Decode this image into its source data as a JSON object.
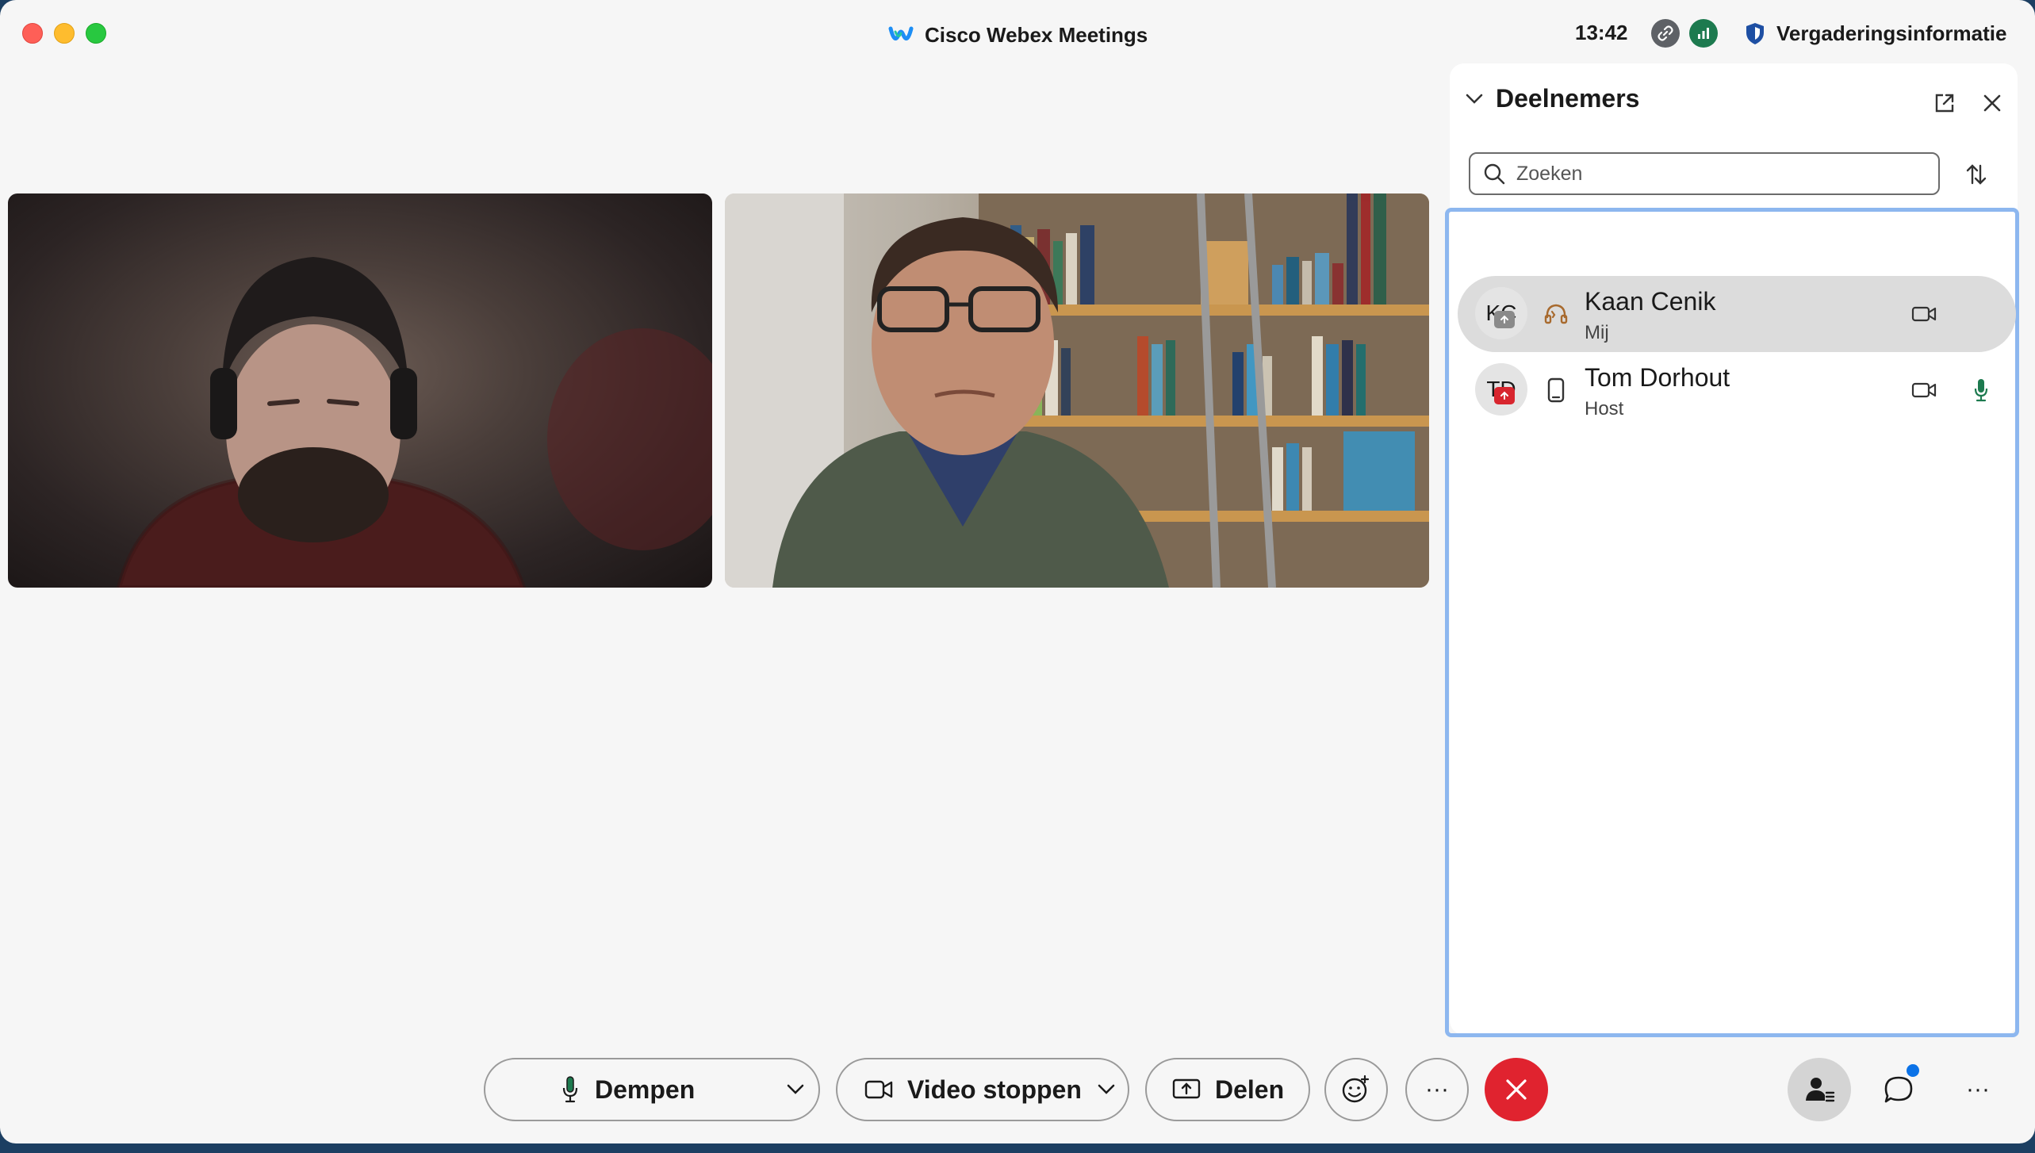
{
  "titlebar": {
    "app_title": "Cisco Webex Meetings",
    "clock": "13:42",
    "meeting_info_label": "Vergaderingsinformatie"
  },
  "panel": {
    "title": "Deelnemers",
    "search_placeholder": "Zoeken",
    "participants": [
      {
        "initials": "KC",
        "name": "Kaan Cenik",
        "role": "Mij"
      },
      {
        "initials": "TD",
        "name": "Tom Dorhout",
        "role": "Host"
      }
    ]
  },
  "toolbar": {
    "mute_label": "Dempen",
    "video_label": "Video stoppen",
    "share_label": "Delen",
    "more_label": "···",
    "overflow_label": "···"
  },
  "colors": {
    "accent": "#8db7ef",
    "leave": "#e0232f",
    "unmuted_mic": "#1d7a4f",
    "notification_dot": "#0b72e7"
  },
  "icons": [
    "webex-logo-icon",
    "link-icon",
    "signal-icon",
    "shield-icon",
    "chevron-down-icon",
    "popout-icon",
    "close-icon",
    "search-icon",
    "sort-icon",
    "headset-icon",
    "phone-device-icon",
    "video-camera-icon",
    "microphone-icon",
    "share-screen-icon",
    "emoji-add-icon",
    "end-call-icon",
    "participants-icon",
    "chat-icon"
  ]
}
